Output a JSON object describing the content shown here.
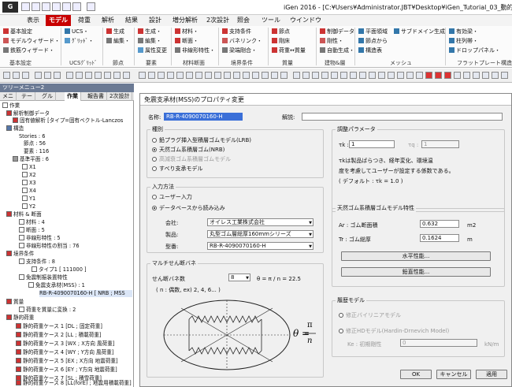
{
  "window": {
    "title": "iGen 2016 - [C:¥Users¥Administrator.JBT¥Desktop¥iGen_Tutorial_03_動的解析¥iGen_Tutori"
  },
  "menu": [
    "表示",
    "モデル",
    "荷重",
    "解析",
    "結果",
    "設計",
    "増分解析",
    "2次設計",
    "照会",
    "ツール",
    "ウインドウ"
  ],
  "menu_active": "モデル",
  "ribbon": {
    "groups": [
      "基本設定",
      "UCSｸﾞﾘｯﾄﾞ",
      "節点",
      "要素",
      "材料断面",
      "境界条件",
      "質量",
      "建物&層",
      "メッシュ",
      "フラットプレート構造"
    ],
    "items": [
      "基本設定",
      "モデルウィザード・",
      "鉄筋ウィザード・",
      "UCS・",
      "ｸﾞﾘｯﾄﾞ・",
      "生成",
      "編集・",
      "生成・",
      "編集・",
      "属性変更",
      "材料・",
      "断面・",
      "非線形特性・",
      "支持条件",
      "バネリンク・",
      "梁端剛合・",
      "節点",
      "剛床",
      "荷重↔質量",
      "制御データ",
      "剛性・",
      "自動生成・",
      "平面領域",
      "節点から",
      "構造表",
      "サブドメイン生成",
      "有効梁・",
      "柱列帯・",
      "ドロップパネル・"
    ]
  },
  "tree": {
    "title": "ツリーメニュー2",
    "tabs": [
      "メニ",
      "テー",
      "グル",
      "作業",
      "報告書",
      "2次設計"
    ],
    "items": [
      "作業",
      "解析制御データ",
      "固有値解析 [タイプ=固有ベクトル-Lanczos",
      "構造",
      "Stories : 6",
      "節点 : 56",
      "要素 : 116",
      "基準平面 : 6",
      "X1",
      "X2",
      "X3",
      "X4",
      "Y1",
      "Y2",
      "材料 & 断面",
      "材料 : 4",
      "断面 : 5",
      "非線形特性 : 5",
      "非線形特性の割当 : 76",
      "境界条件",
      "支持条件 : 8",
      "タイプ1 [ 111000 ]",
      "免震制振装置特性",
      "免震支承材(MSS) : 1",
      "RB-R-4090070160-H [ NRB ; MSS",
      "質量",
      "荷重を質量に変換 : 2",
      "静的荷重",
      "静的荷重ケース 1 [DL ; 固定荷重]",
      "静的荷重ケース 2 [LL ; 積載荷重]",
      "静的荷重ケース 3 [WX ; X方向 風荷重]",
      "静的荷重ケース 4 [WY ; Y方向 風荷重]",
      "静的荷重ケース 5 [EX ; X方向 地震荷重]",
      "静的荷重ケース 6 [EY ; Y方向 地震荷重]",
      "静的荷重ケース 7 [SL ; 積雪荷重]",
      "静的荷重ケース 8 [LL(forE) ; 地震用積載荷重]"
    ]
  },
  "dialog": {
    "title": "免震支承材(MSS)のプロパティ変更",
    "name_label": "名称:",
    "name_value": "RB-R-4090070160-H",
    "desc_label": "解説:",
    "desc_value": "",
    "type_legend": "種別",
    "types": [
      "鉛プラグ挿入型積層ゴムモデル(LRB)",
      "天然ゴム系積層ゴム(NRB)",
      "高減衰ゴム系積層ゴムモデル",
      "すべり支承モデル"
    ],
    "input_legend": "入力方法",
    "input_methods": [
      "ユーザー入力",
      "データベースから読み込み"
    ],
    "company_label": "会社:",
    "company_value": "オイレス工業株式会社",
    "product_label": "製品:",
    "product_value": "丸型ゴム層総厚160mmシリーズ",
    "model_label": "型番:",
    "model_value": "RB-R-4090070160-H",
    "multi_legend": "マルチせん断バネ",
    "spring_count_label": "せん断バネ数",
    "spring_count_value": "8",
    "formula": "θ = π / n = 22.5",
    "spring_hint": "( n : 偶数, ex) 2, 4, 6... )",
    "theta_num": "π",
    "theta_den": "n",
    "theta_sym": "θ =",
    "adjust_legend": "調整パラメータ",
    "tk_label": "τk :",
    "tk_value": "1",
    "tq_label": "τq :",
    "tq_value": "1",
    "adjust_note1": "τkは製品ばらつき、経年変化、環境温",
    "adjust_note2": "度を考慮してユーザーが設定する係数である。",
    "adjust_default": "( デフォルト : τk = 1.0 )",
    "nrb_legend": "天然ゴム系積層ゴムモデル特性",
    "ar_label": "Ar : ゴム断面積",
    "ar_value": "0.632",
    "ar_unit": "m2",
    "tr_label": "Tr : ゴム総厚",
    "tr_value": "0.1624",
    "tr_unit": "m",
    "horiz_btn": "水平性能...",
    "vert_btn": "鉛直性能...",
    "hist_legend": "履歴モデル",
    "hist_models": [
      "修正バイリニアモデル",
      "修正HDモデル(Hardin-Drnevich Model)"
    ],
    "ke_label": "Ke : 初期剛性",
    "ke_value": "0",
    "ke_unit": "kN/m",
    "ok": "OK",
    "cancel": "キャンセル",
    "apply": "適用"
  },
  "colors": {
    "accent": "#c80000",
    "tree_title": "#6b7a94"
  }
}
